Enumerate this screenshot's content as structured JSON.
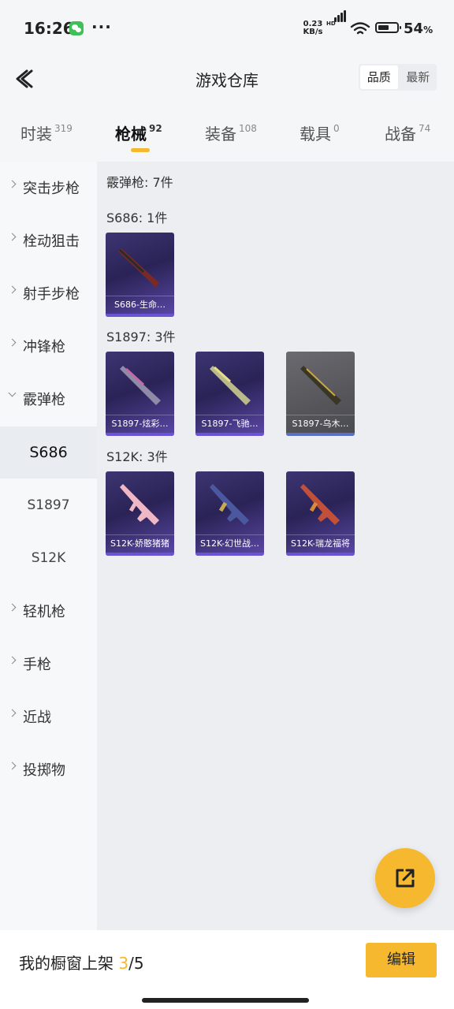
{
  "status": {
    "time": "16:26",
    "net_speed_value": "0.23",
    "net_speed_unit": "KB/s",
    "hd_label": "HD",
    "battery_value": "54",
    "battery_unit": "%"
  },
  "header": {
    "title": "游戏仓库",
    "sort_options": [
      "品质",
      "最新"
    ]
  },
  "tabs": [
    {
      "label": "时装",
      "count": "319"
    },
    {
      "label": "枪械",
      "count": "92"
    },
    {
      "label": "装备",
      "count": "108"
    },
    {
      "label": "载具",
      "count": "0"
    },
    {
      "label": "战备",
      "count": "74"
    }
  ],
  "sidebar": {
    "categories": [
      "突击步枪",
      "栓动狙击",
      "射手步枪",
      "冲锋枪",
      "霰弹枪",
      "轻机枪",
      "手枪",
      "近战",
      "投掷物"
    ],
    "sub_items": [
      "S686",
      "S1897",
      "S12K"
    ]
  },
  "content": {
    "category_summary": "霰弹枪: 7件",
    "groups": [
      {
        "label": "S686: 1件",
        "items": [
          "S686-生命…"
        ]
      },
      {
        "label": "S1897: 3件",
        "items": [
          "S1897-炫彩…",
          "S1897-飞驰…",
          "S1897-乌木…"
        ]
      },
      {
        "label": "S12K: 3件",
        "items": [
          "S12K-娇憨猪猪",
          "S12K-幻世战…",
          "S12K-瑞龙福将"
        ]
      }
    ]
  },
  "bottom_bar": {
    "showcase_label": "我的橱窗上架",
    "showcase_current": "3",
    "showcase_total": "/5",
    "edit_label": "编辑"
  },
  "colors": {
    "accent": "#f5b82e",
    "card_purple": "#3d3572",
    "card_grey": "#6a6a70"
  }
}
